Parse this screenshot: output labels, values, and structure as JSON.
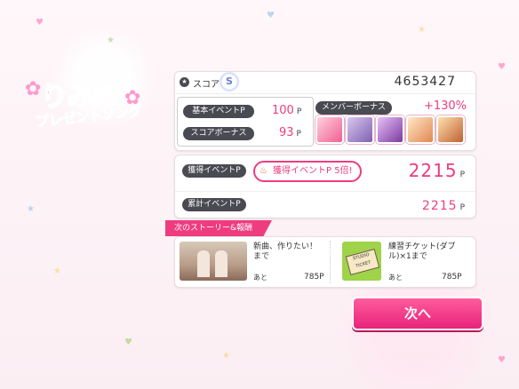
{
  "event": {
    "logo_title": "りみの",
    "logo_subtitle": "プレゼントソング"
  },
  "score": {
    "label": "スコア",
    "rank": "S",
    "value": "4653427"
  },
  "bonus": {
    "base_event_label": "基本イベントP",
    "base_event_value": "100",
    "score_bonus_label": "スコアボーナス",
    "score_bonus_value": "93",
    "p_unit": "P",
    "member_bonus_label": "メンバーボーナス",
    "member_bonus_value": "+130%"
  },
  "event_points": {
    "earned_label": "獲得イベントP",
    "multiplier_text": "獲得イベントP 5倍!",
    "earned_value": "2215",
    "total_label": "累計イベントP",
    "total_value": "2215",
    "p_unit": "P"
  },
  "next_story": {
    "tab_label": "次のストーリー&報酬",
    "items": [
      {
        "title": "新曲、作りたい！まで",
        "remaining_label": "あと",
        "remaining_value": "785P"
      },
      {
        "title": "練習チケット(ダブル)×1まで",
        "remaining_label": "あと",
        "remaining_value": "785P",
        "ticket_text": "STUDIO TICKET"
      }
    ]
  },
  "next_button_label": "次へ",
  "colors": {
    "accent": "#ee3c7f",
    "label_bg": "#4a4a52"
  }
}
